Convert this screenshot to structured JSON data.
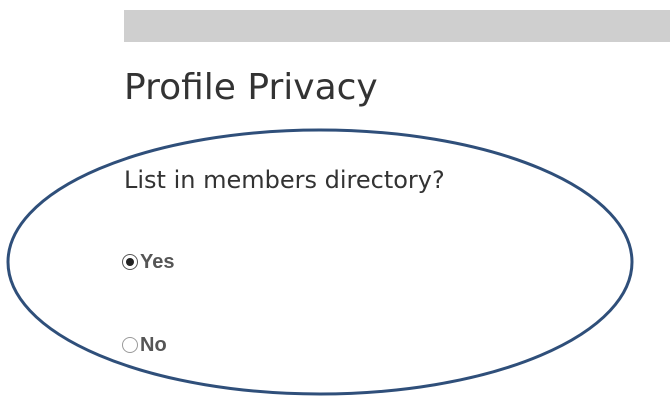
{
  "section": {
    "title": "Profile Privacy"
  },
  "directory_question": {
    "label": "List in members directory?",
    "options": [
      {
        "label": "Yes",
        "selected": true
      },
      {
        "label": "No",
        "selected": false
      }
    ]
  },
  "colors": {
    "top_bar": "#cfcfcf",
    "text": "#333333",
    "radio_text": "#555555",
    "highlight_oval": "#2f4f7a"
  },
  "icons": {
    "selected_radio": "radio-selected-icon",
    "unselected_radio": "radio-unselected-icon"
  }
}
